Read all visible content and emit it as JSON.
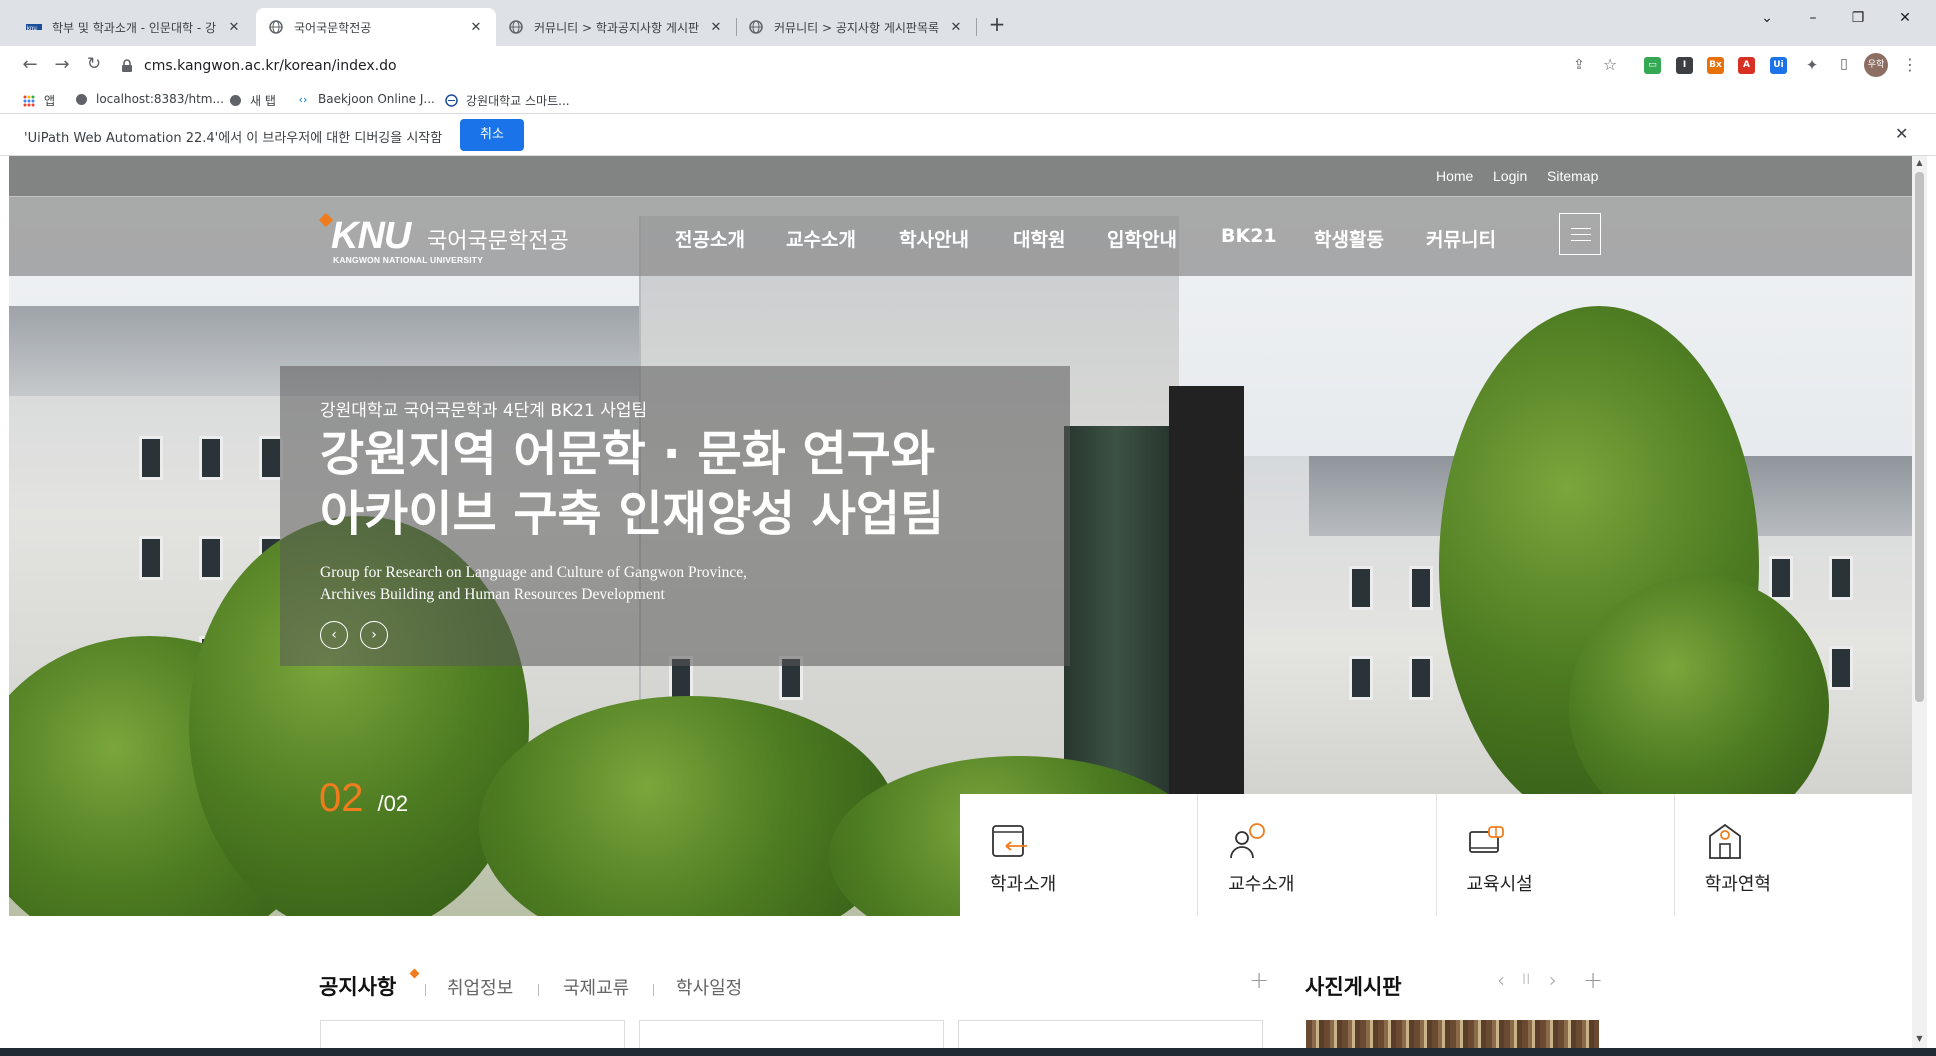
{
  "browser": {
    "tabs": [
      {
        "title": "학부 및 학과소개 - 인문대학 - 강",
        "active": false
      },
      {
        "title": "국어국문학전공",
        "active": true
      },
      {
        "title": "커뮤니티 > 학과공지사항 게시판",
        "active": false
      },
      {
        "title": "커뮤니티 > 공지사항 게시판목록",
        "active": false
      }
    ],
    "new_tab": "+",
    "window_controls": {
      "dropdown": "⌄",
      "minimize": "–",
      "restore": "❐",
      "close": "✕"
    },
    "url": "cms.kangwon.ac.kr/korean/index.do",
    "profile_badge": "우학",
    "bookmarks": [
      {
        "label": "앱",
        "icon": "apps-grid-icon"
      },
      {
        "label": "localhost:8383/htm...",
        "icon": "globe-icon"
      },
      {
        "label": "새 탭",
        "icon": "globe-icon"
      },
      {
        "label": "Baekjoon Online J...",
        "icon": "code-icon"
      },
      {
        "label": "강원대학교 스마트...",
        "icon": "circle-logo-icon"
      }
    ],
    "infobar": {
      "message": "'UiPath Web Automation 22.4'에서 이 브라우저에 대한 디버깅을 시작함",
      "cancel_label": "취소",
      "close": "✕"
    }
  },
  "site": {
    "utility_links": [
      "Home",
      "Login",
      "Sitemap"
    ],
    "logo": {
      "mark": "KNU",
      "dept": "국어국문학전공",
      "university": "KANGWON NATIONAL UNIVERSITY"
    },
    "menu": [
      "전공소개",
      "교수소개",
      "학사안내",
      "대학원",
      "입학안내",
      "BK21",
      "학생활동",
      "커뮤니티"
    ],
    "hero": {
      "subtitle": "강원대학교 국어국문학과 4단계 BK21 사업팀",
      "headline_1": "강원지역 어문학 · 문화 연구와",
      "headline_2": "아카이브 구축 인재양성 사업팀",
      "english_1": "Group for Research on Language and Culture of Gangwon Province,",
      "english_2": "Archives Building and Human Resources Development",
      "prev": "‹",
      "next": "›",
      "counter_current": "02",
      "counter_total": "/02"
    },
    "quick_links": [
      {
        "label": "학과소개",
        "icon": "department-book-icon"
      },
      {
        "label": "교수소개",
        "icon": "professor-person-icon"
      },
      {
        "label": "교육시설",
        "icon": "facility-screen-icon"
      },
      {
        "label": "학과연혁",
        "icon": "history-building-icon"
      }
    ],
    "board_tabs": [
      "공지사항",
      "취업정보",
      "국제교류",
      "학사일정"
    ],
    "photo_board": {
      "title": "사진게시판",
      "prev": "‹",
      "pause": "II",
      "next": "›",
      "more": "+"
    },
    "board_more": "+"
  },
  "colors": {
    "accent": "#f07c1e",
    "infobar_button": "#1a73e8"
  }
}
